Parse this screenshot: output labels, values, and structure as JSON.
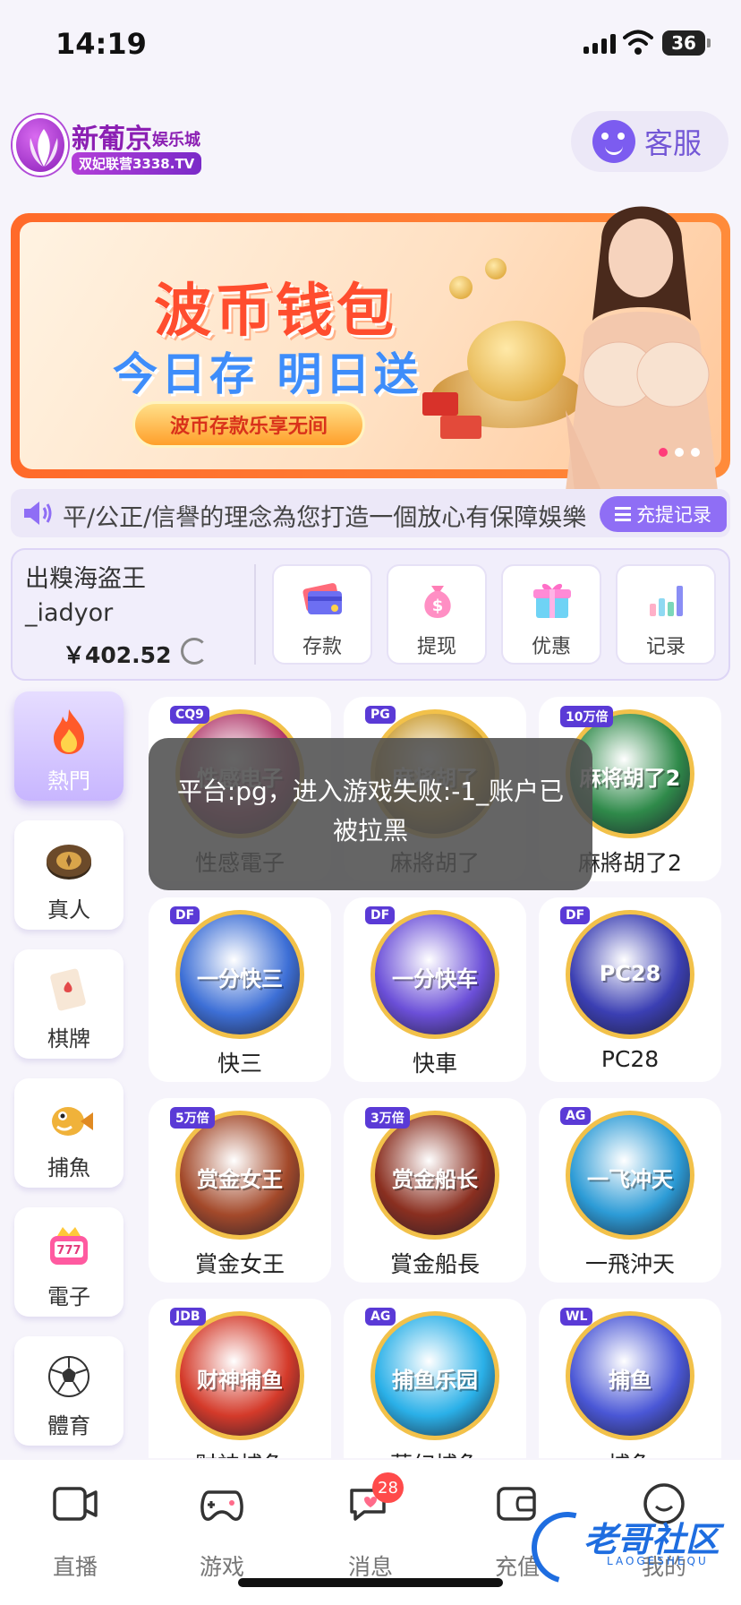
{
  "status": {
    "time": "14:19",
    "battery": "36"
  },
  "header": {
    "logo_title": "新葡京",
    "logo_sub": "娱乐城",
    "logo_tag": "双妃联营3338.TV",
    "cs_label": "客服"
  },
  "banner": {
    "title": "波币钱包",
    "subtitle": "今日存 明日送",
    "cta": "波币存款乐享无间",
    "slides": 3,
    "active_slide": 1
  },
  "notice": {
    "text": "平/公正/信譽的理念為您打造一個放心有保障娛樂",
    "button": "充提记录"
  },
  "wallet": {
    "username": "出糗海盗王_iadyor",
    "username_line1": "出糗海盗王",
    "username_line2": "_iadyor",
    "balance": "￥402.52",
    "actions": [
      {
        "label": "存款",
        "icon": "card-icon"
      },
      {
        "label": "提现",
        "icon": "money-bag-icon"
      },
      {
        "label": "优惠",
        "icon": "gift-icon"
      },
      {
        "label": "记录",
        "icon": "bar-chart-icon"
      }
    ]
  },
  "sidebar": {
    "items": [
      {
        "label": "熱門",
        "icon": "fire-icon",
        "active": true
      },
      {
        "label": "真人",
        "icon": "casino-chip-icon",
        "active": false
      },
      {
        "label": "棋牌",
        "icon": "playing-card-icon",
        "active": false
      },
      {
        "label": "捕魚",
        "icon": "fish-icon",
        "active": false
      },
      {
        "label": "電子",
        "icon": "slot-machine-icon",
        "active": false
      },
      {
        "label": "體育",
        "icon": "soccer-ball-icon",
        "active": false
      }
    ]
  },
  "games": [
    {
      "name": "性感電子",
      "badge": "CQ9",
      "art": "性感电子",
      "color": "#b13a6c"
    },
    {
      "name": "麻將胡了",
      "badge": "PG",
      "art": "麻将胡了",
      "color": "#c99a2e"
    },
    {
      "name": "麻將胡了2",
      "badge": "10万倍",
      "art": "麻将胡了2",
      "color": "#2f8a4a"
    },
    {
      "name": "快三",
      "badge": "DF",
      "art": "一分快三",
      "color": "#3d6fd6"
    },
    {
      "name": "快車",
      "badge": "DF",
      "art": "一分快车",
      "color": "#6b4fd8"
    },
    {
      "name": "PC28",
      "badge": "DF",
      "art": "PC28",
      "color": "#3b3fb3"
    },
    {
      "name": "賞金女王",
      "badge": "5万倍",
      "art": "赏金女王",
      "color": "#a3492a"
    },
    {
      "name": "賞金船長",
      "badge": "3万倍",
      "art": "赏金船长",
      "color": "#8a2f20"
    },
    {
      "name": "一飛沖天",
      "badge": "AG",
      "art": "一飞冲天",
      "color": "#2c9bd6"
    },
    {
      "name": "财神捕鱼",
      "badge": "JDB",
      "art": "财神捕鱼",
      "color": "#d43a2a"
    },
    {
      "name": "夢幻捕魚",
      "badge": "AG",
      "art": "捕鱼乐园",
      "color": "#2ab0e8"
    },
    {
      "name": "捕魚",
      "badge": "WL",
      "art": "捕鱼",
      "color": "#4a57d6"
    }
  ],
  "toast": {
    "message": "平台:pg，进入游戏失败:-1_账户已被拉黑"
  },
  "tabbar": {
    "items": [
      {
        "label": "直播",
        "icon": "camera-icon"
      },
      {
        "label": "游戏",
        "icon": "gamepad-icon"
      },
      {
        "label": "消息",
        "icon": "chat-icon",
        "badge": "28"
      },
      {
        "label": "充值",
        "icon": "wallet-icon"
      },
      {
        "label": "我的",
        "icon": "profile-icon"
      }
    ]
  },
  "watermark": {
    "text": "老哥社区",
    "sub": "LAOGESHEQU"
  }
}
